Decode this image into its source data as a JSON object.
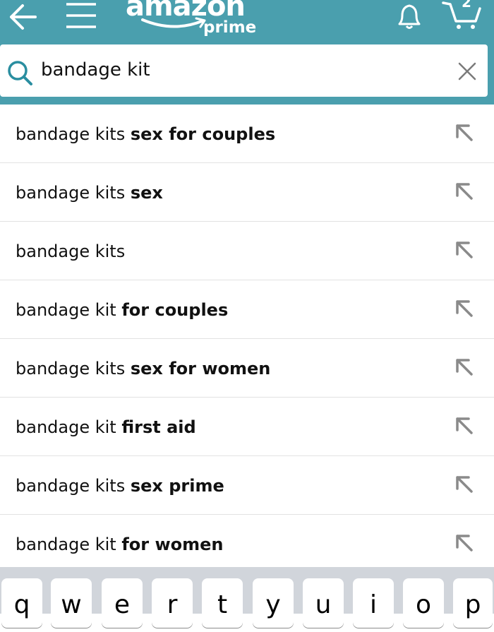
{
  "header": {
    "logo_word": "amazon",
    "logo_prime": "prime",
    "cart_count": "2",
    "icons": [
      "back-arrow-icon",
      "menu-icon",
      "bell-icon",
      "cart-icon"
    ],
    "bar_color": "#4a9fae"
  },
  "search": {
    "value": "bandage kit",
    "icon": "search-icon",
    "clear_icon": "close-icon"
  },
  "suggestions": [
    {
      "prefix": "bandage kit",
      "rest_plain": "s ",
      "bold": "sex for couples"
    },
    {
      "prefix": "bandage kit",
      "rest_plain": "s ",
      "bold": "sex"
    },
    {
      "prefix": "bandage kit",
      "rest_plain": "s",
      "bold": ""
    },
    {
      "prefix": "bandage kit",
      "rest_plain": " ",
      "bold": "for couples"
    },
    {
      "prefix": "bandage kit",
      "rest_plain": "s ",
      "bold": "sex for women"
    },
    {
      "prefix": "bandage kit",
      "rest_plain": " ",
      "bold": "first aid"
    },
    {
      "prefix": "bandage kit",
      "rest_plain": "s ",
      "bold": "sex prime"
    },
    {
      "prefix": "bandage kit",
      "rest_plain": " ",
      "bold": "for women"
    }
  ],
  "keyboard": {
    "keys": [
      "q",
      "w",
      "e",
      "r",
      "t",
      "y",
      "u",
      "i",
      "o",
      "p"
    ]
  }
}
